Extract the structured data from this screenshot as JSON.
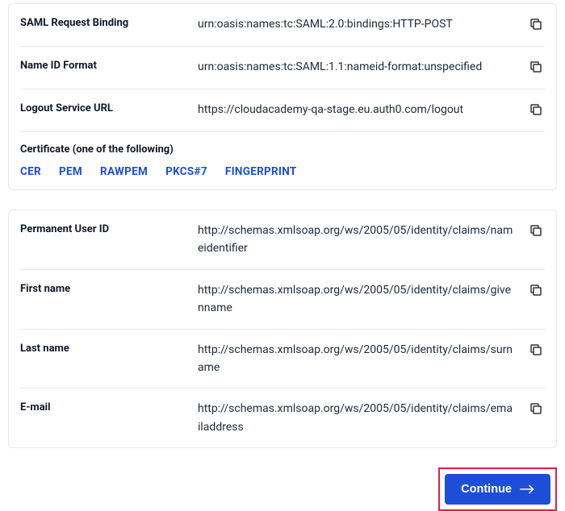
{
  "saml": {
    "rows": [
      {
        "label": "SAML Request Binding",
        "value": "urn:oasis:names:tc:SAML:2.0:bindings:HTTP-POST"
      },
      {
        "label": "Name ID Format",
        "value": "urn:oasis:names:tc:SAML:1.1:nameid-format:unspecified"
      },
      {
        "label": "Logout Service URL",
        "value": "https://cloudacademy-qa-stage.eu.auth0.com/logout"
      }
    ],
    "cert_header": "Certificate (one of the following)",
    "cert_tabs": [
      "CER",
      "PEM",
      "RAWPEM",
      "PKCS#7",
      "FINGERPRINT"
    ]
  },
  "claims": {
    "rows": [
      {
        "label": "Permanent User ID",
        "value": "http://schemas.xmlsoap.org/ws/2005/05/identity/claims/nameidentifier"
      },
      {
        "label": "First name",
        "value": "http://schemas.xmlsoap.org/ws/2005/05/identity/claims/givenname"
      },
      {
        "label": "Last name",
        "value": "http://schemas.xmlsoap.org/ws/2005/05/identity/claims/surname"
      },
      {
        "label": "E-mail",
        "value": "http://schemas.xmlsoap.org/ws/2005/05/identity/claims/emailaddress"
      }
    ]
  },
  "footer": {
    "continue": "Continue"
  }
}
